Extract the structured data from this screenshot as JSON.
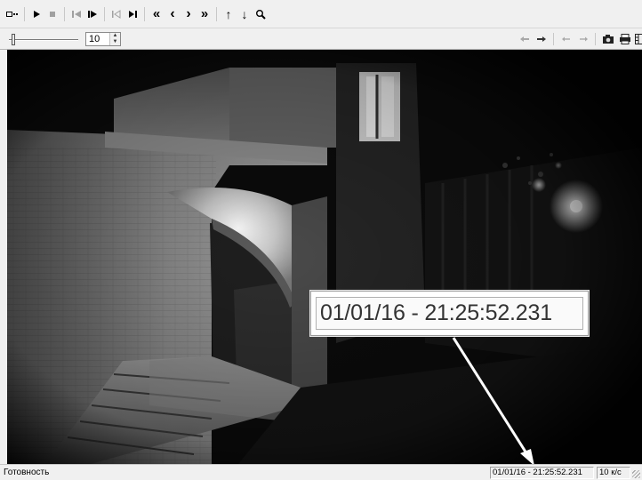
{
  "toolbar": {
    "buttons": [
      "frame-view",
      "play",
      "stop",
      "step-back",
      "step-forward",
      "go-start",
      "go-end",
      "fast-rewind",
      "prev",
      "next",
      "fast-forward",
      "up",
      "down",
      "search"
    ],
    "glyphs": {
      "fast_rewind": "«",
      "prev": "‹",
      "next": "›",
      "fast_forward": "»",
      "up": "↑",
      "down": "↓"
    }
  },
  "speed": {
    "value": "10"
  },
  "video": {
    "overlay_timestamp": "01/01/16 - 21:25:52.231"
  },
  "status": {
    "text": "Готовность",
    "timestamp": "01/01/16 - 21:25:52.231",
    "fps": "10 к/с"
  },
  "colors": {
    "window_bg": "#f0f0f0",
    "video_bg": "#000000",
    "arrow": "#ffffff"
  }
}
